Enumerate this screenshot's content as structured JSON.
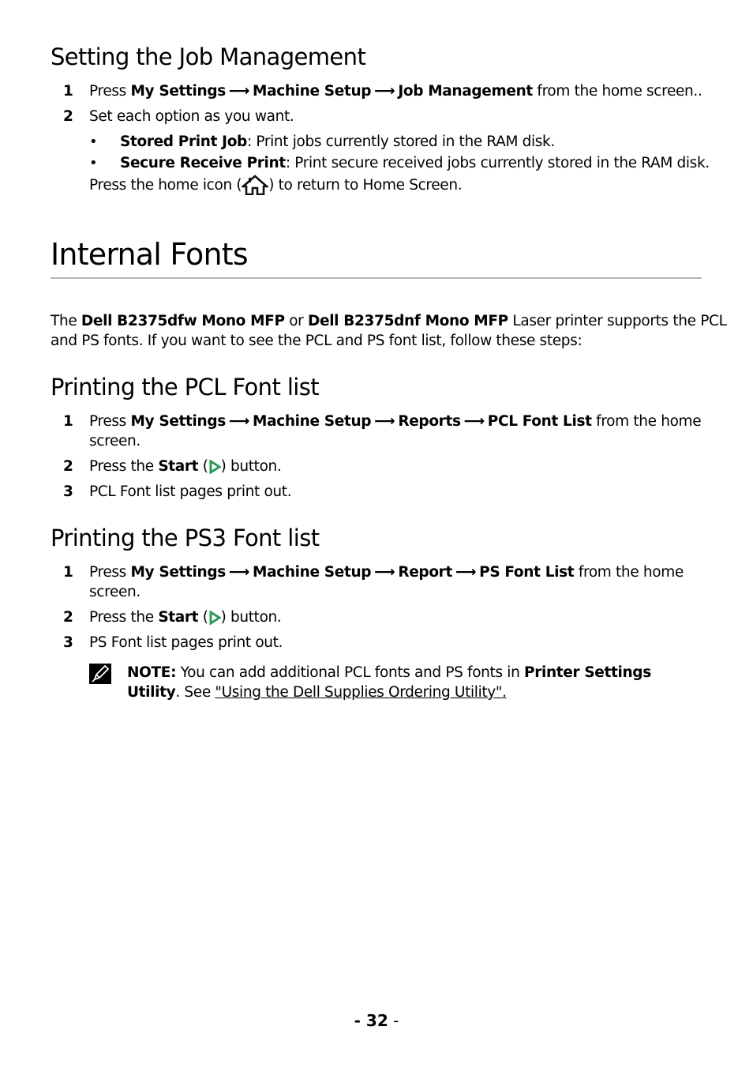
{
  "section_job": {
    "title": "Setting the Job Management",
    "step1": {
      "num": "1",
      "prefix": "Press ",
      "path": [
        "My Settings",
        "Machine Setup",
        "Job Management"
      ],
      "suffix": " from the home screen.."
    },
    "step2": {
      "num": "2",
      "text": "Set each option as you want."
    },
    "bullets": [
      {
        "term": "Stored Print Job",
        "text": ": Print jobs currently stored in the RAM disk."
      },
      {
        "term": "Secure Receive Print",
        "text": ": Print secure received jobs currently stored in the RAM disk."
      }
    ],
    "home_line": {
      "before": "Press the home icon (",
      "icon": "home-icon",
      "after": ") to return to Home Screen."
    }
  },
  "section_fonts": {
    "title": "Internal Fonts",
    "intro": {
      "t1": "The ",
      "b1": "Dell B2375dfw Mono MFP",
      "t2": " or ",
      "b2": "Dell B2375dnf Mono MFP",
      "t3": " Laser printer supports the PCL",
      "line2": "and PS fonts. If you want to see the PCL and PS font list, follow these steps:"
    }
  },
  "section_pcl": {
    "title": "Printing the PCL Font list",
    "step1": {
      "num": "1",
      "prefix": "Press ",
      "path": [
        "My Settings",
        "Machine Setup",
        "Reports",
        "PCL Font List"
      ],
      "suffix": " from the home",
      "cont": "screen."
    },
    "step2": {
      "num": "2",
      "before": "Press the ",
      "bold": "Start",
      "mid": " (",
      "icon": "start-play-icon",
      "after": ") button."
    },
    "step3": {
      "num": "3",
      "text": "PCL Font list pages print out."
    }
  },
  "section_ps3": {
    "title": "Printing the PS3 Font list",
    "step1": {
      "num": "1",
      "prefix": "Press ",
      "path": [
        "My Settings",
        "Machine Setup",
        "Report",
        "PS Font List"
      ],
      "suffix": " from the home",
      "cont": "screen."
    },
    "step2": {
      "num": "2",
      "before": "Press the ",
      "bold": "Start",
      "mid": " (",
      "icon": "start-play-icon",
      "after": ") button."
    },
    "step3": {
      "num": "3",
      "text": "PS Font list pages print out."
    },
    "note": {
      "icon": "note-pencil-icon",
      "label": "NOTE:",
      "text1": " You can add additional PCL fonts and PS fonts in ",
      "bold1": "Printer Settings",
      "bold2": "Utility",
      "text2": ". See ",
      "link": "\"Using the Dell Supplies Ordering Utility\"."
    }
  },
  "arrow_glyph": "⟶",
  "colors": {
    "start_icon": "#2e9a5a",
    "rule": "#b3b3b3"
  },
  "footer": {
    "page_bold": "- 32",
    "page_tail": " -"
  }
}
